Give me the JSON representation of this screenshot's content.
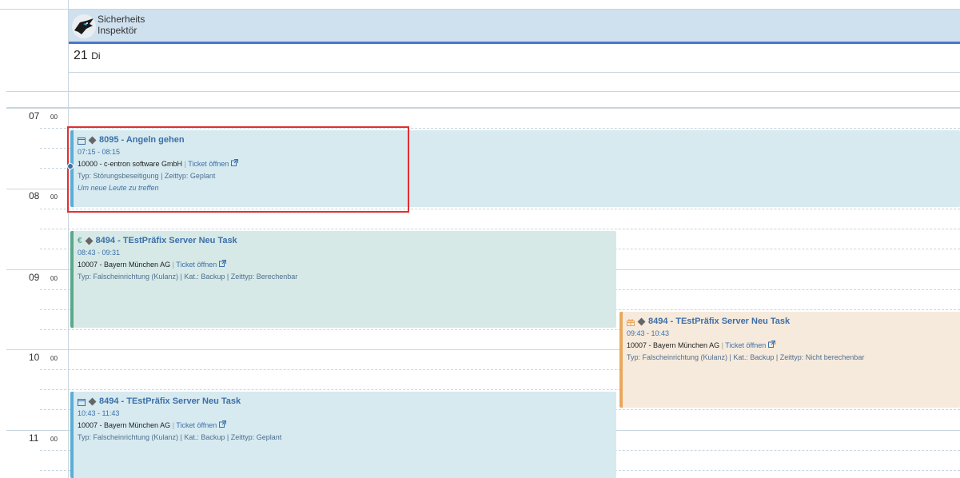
{
  "resource": {
    "name_line1": "Sicherheits",
    "name_line2": "Inspektör",
    "avatar_icon": "panther-logo-icon"
  },
  "day": {
    "number": "21",
    "weekday": "Di"
  },
  "hours": [
    {
      "hour": "07",
      "minute": "00"
    },
    {
      "hour": "08",
      "minute": "00"
    },
    {
      "hour": "09",
      "minute": "00"
    },
    {
      "hour": "10",
      "minute": "00"
    },
    {
      "hour": "11",
      "minute": "00"
    }
  ],
  "events": [
    {
      "icon": "calendar-icon",
      "title": "8095 - Angeln gehen",
      "time": "07:15 - 08:15",
      "client": "10000 - c-entron software GmbH",
      "link": "Ticket öffnen",
      "type": "Typ: Störungsbeseitigung | Zeittyp: Geplant",
      "note": "Um neue Leute zu treffen",
      "color": "#d6eaf0",
      "border": "#5aaed6"
    },
    {
      "icon": "euro-icon",
      "title": "8494 - TEstPräfix Server Neu Task",
      "time": "08:43 - 09:31",
      "client": "10007 - Bayern München AG",
      "link": "Ticket öffnen",
      "type": "Typ: Falscheinrichtung (Kulanz) | Kat.: Backup | Zeittyp: Berechenbar",
      "color": "#d6e9e7",
      "border": "#5aa88a"
    },
    {
      "icon": "gift-icon",
      "title": "8494 - TEstPräfix Server Neu Task",
      "time": "09:43 - 10:43",
      "client": "10007 - Bayern München AG",
      "link": "Ticket öffnen",
      "type": "Typ: Falscheinrichtung (Kulanz) | Kat.: Backup | Zeittyp: Nicht berechenbar",
      "color": "#f6eadc",
      "border": "#e9a85e"
    },
    {
      "icon": "calendar-icon",
      "title": "8494 - TEstPräfix Server Neu Task",
      "time": "10:43 - 11:43",
      "client": "10007 - Bayern München AG",
      "link": "Ticket öffnen",
      "type": "Typ: Falscheinrichtung (Kulanz) | Kat.: Backup | Zeittyp: Geplant",
      "color": "#d6eaf0",
      "border": "#5aaed6"
    }
  ]
}
